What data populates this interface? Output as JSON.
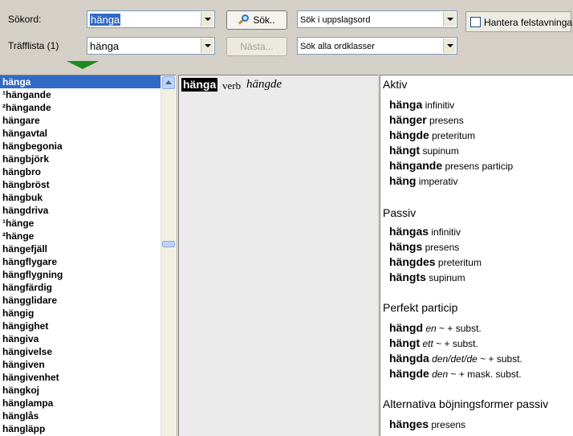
{
  "toolbar": {
    "search_label": "Sökord:",
    "search_value": "hänga",
    "hitlist_label": "Träfflista (1)",
    "hitlist_value": "hänga",
    "search_button": "Sök..",
    "next_button": "Nästa...",
    "search_mode": "Sök i uppslagsord",
    "word_class": "Sök alla ordklasser",
    "misspelling_label": "Hantera felstavningar"
  },
  "word_list": [
    "hänga",
    "¹hängande",
    "²hängande",
    "hängare",
    "hängavtal",
    "hängbegonia",
    "hängbjörk",
    "hängbro",
    "hängbröst",
    "hängbuk",
    "hängdriva",
    "¹hänge",
    "²hänge",
    "hängefjäll",
    "hängflygare",
    "hängflygning",
    "hängfärdig",
    "hängglidare",
    "hängig",
    "hängighet",
    "hängiva",
    "hängivelse",
    "hängiven",
    "hängivenhet",
    "hängkoj",
    "hänglampa",
    "hänglås",
    "hängläpp"
  ],
  "entry": {
    "headword": "hänga",
    "pos": "verb",
    "past": "hängde"
  },
  "inflection": {
    "aktiv": {
      "title": "Aktiv",
      "forms": [
        {
          "word": "hänga",
          "desc": "infinitiv"
        },
        {
          "word": "hänger",
          "desc": "presens"
        },
        {
          "word": "hängde",
          "desc": "preteritum"
        },
        {
          "word": "hängt",
          "desc": "supinum"
        },
        {
          "word": "hängande",
          "desc": "presens particip"
        },
        {
          "word": "häng",
          "desc": "imperativ"
        }
      ]
    },
    "passiv": {
      "title": "Passiv",
      "forms": [
        {
          "word": "hängas",
          "desc": "infinitiv"
        },
        {
          "word": "hängs",
          "desc": "presens"
        },
        {
          "word": "hängdes",
          "desc": "preteritum"
        },
        {
          "word": "hängts",
          "desc": "supinum"
        }
      ]
    },
    "perfekt": {
      "title": "Perfekt particip",
      "forms": [
        {
          "word": "hängd",
          "art": "en",
          "desc": "~ + subst."
        },
        {
          "word": "hängt",
          "art": "ett",
          "desc": "~ + subst."
        },
        {
          "word": "hängda",
          "art": "den/det/de",
          "desc": "~ + subst."
        },
        {
          "word": "hängde",
          "art": "den",
          "desc": "~ + mask. subst."
        }
      ]
    },
    "alt": {
      "title": "Alternativa böjningsformer passiv",
      "forms": [
        {
          "word": "hänges",
          "desc": "presens"
        }
      ]
    }
  },
  "icons": {
    "search_button_icon": "magnifier-icon",
    "dropdown_icon": "chevron-down-icon",
    "scroll_up_icon": "scroll-up-arrow-icon",
    "pointer_icon": "green-down-arrow-icon"
  },
  "colors": {
    "selection": "#316ac5",
    "toolbar_bg": "#d4d0c8",
    "arrow_green": "#1c8a1c"
  }
}
